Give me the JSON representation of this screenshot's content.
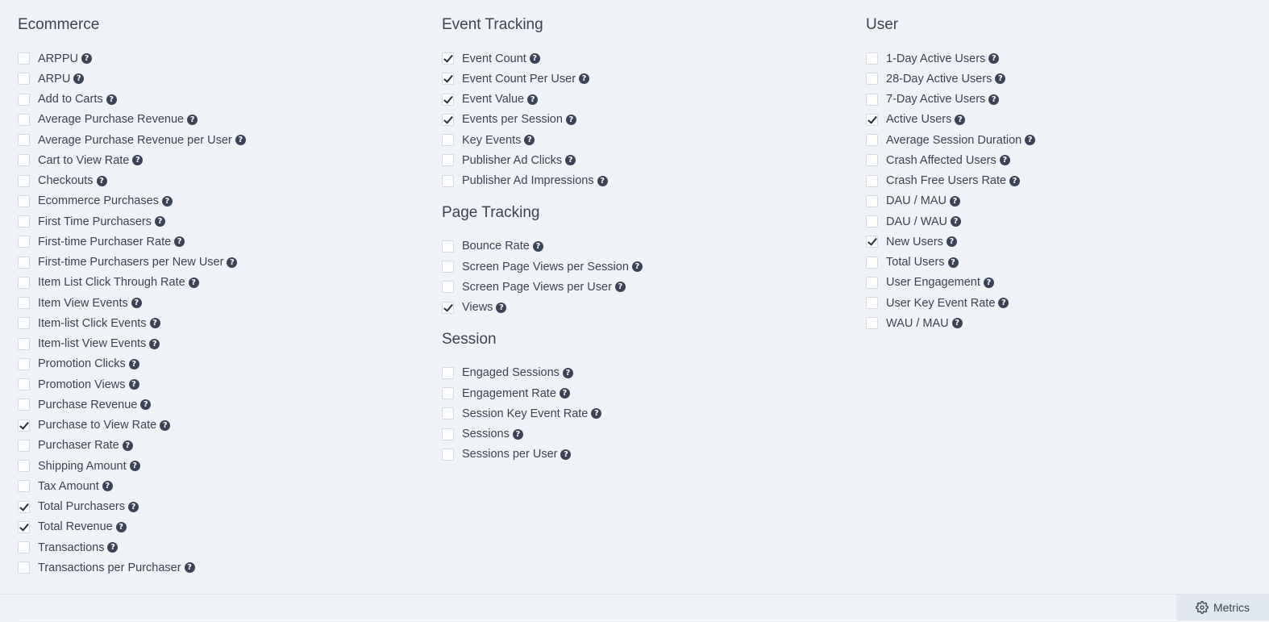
{
  "help_glyph": "?",
  "groups": {
    "ecommerce": {
      "title": "Ecommerce",
      "items": [
        {
          "label": "ARPPU",
          "checked": false
        },
        {
          "label": "ARPU",
          "checked": false
        },
        {
          "label": "Add to Carts",
          "checked": false
        },
        {
          "label": "Average Purchase Revenue",
          "checked": false
        },
        {
          "label": "Average Purchase Revenue per User",
          "checked": false
        },
        {
          "label": "Cart to View Rate",
          "checked": false
        },
        {
          "label": "Checkouts",
          "checked": false
        },
        {
          "label": "Ecommerce Purchases",
          "checked": false
        },
        {
          "label": "First Time Purchasers",
          "checked": false
        },
        {
          "label": "First-time Purchaser Rate",
          "checked": false
        },
        {
          "label": "First-time Purchasers per New User",
          "checked": false
        },
        {
          "label": "Item List Click Through Rate",
          "checked": false
        },
        {
          "label": "Item View Events",
          "checked": false
        },
        {
          "label": "Item-list Click Events",
          "checked": false
        },
        {
          "label": "Item-list View Events",
          "checked": false
        },
        {
          "label": "Promotion Clicks",
          "checked": false
        },
        {
          "label": "Promotion Views",
          "checked": false
        },
        {
          "label": "Purchase Revenue",
          "checked": false
        },
        {
          "label": "Purchase to View Rate",
          "checked": true
        },
        {
          "label": "Purchaser Rate",
          "checked": false
        },
        {
          "label": "Shipping Amount",
          "checked": false
        },
        {
          "label": "Tax Amount",
          "checked": false
        },
        {
          "label": "Total Purchasers",
          "checked": true
        },
        {
          "label": "Total Revenue",
          "checked": true
        },
        {
          "label": "Transactions",
          "checked": false
        },
        {
          "label": "Transactions per Purchaser",
          "checked": false
        }
      ]
    },
    "event_tracking": {
      "title": "Event Tracking",
      "items": [
        {
          "label": "Event Count",
          "checked": true
        },
        {
          "label": "Event Count Per User",
          "checked": true
        },
        {
          "label": "Event Value",
          "checked": true
        },
        {
          "label": "Events per Session",
          "checked": true
        },
        {
          "label": "Key Events",
          "checked": false
        },
        {
          "label": "Publisher Ad Clicks",
          "checked": false
        },
        {
          "label": "Publisher Ad Impressions",
          "checked": false
        }
      ]
    },
    "page_tracking": {
      "title": "Page Tracking",
      "items": [
        {
          "label": "Bounce Rate",
          "checked": false
        },
        {
          "label": "Screen Page Views per Session",
          "checked": false
        },
        {
          "label": "Screen Page Views per User",
          "checked": false
        },
        {
          "label": "Views",
          "checked": true
        }
      ]
    },
    "session": {
      "title": "Session",
      "items": [
        {
          "label": "Engaged Sessions",
          "checked": false
        },
        {
          "label": "Engagement Rate",
          "checked": false
        },
        {
          "label": "Session Key Event Rate",
          "checked": false
        },
        {
          "label": "Sessions",
          "checked": false
        },
        {
          "label": "Sessions per User",
          "checked": false
        }
      ]
    },
    "user": {
      "title": "User",
      "items": [
        {
          "label": "1-Day Active Users",
          "checked": false
        },
        {
          "label": "28-Day Active Users",
          "checked": false
        },
        {
          "label": "7-Day Active Users",
          "checked": false
        },
        {
          "label": "Active Users",
          "checked": true
        },
        {
          "label": "Average Session Duration",
          "checked": false
        },
        {
          "label": "Crash Affected Users",
          "checked": false
        },
        {
          "label": "Crash Free Users Rate",
          "checked": false
        },
        {
          "label": "DAU / MAU",
          "checked": false
        },
        {
          "label": "DAU / WAU",
          "checked": false
        },
        {
          "label": "New Users",
          "checked": true
        },
        {
          "label": "Total Users",
          "checked": false
        },
        {
          "label": "User Engagement",
          "checked": false
        },
        {
          "label": "User Key Event Rate",
          "checked": false
        },
        {
          "label": "WAU / MAU",
          "checked": false
        }
      ]
    }
  },
  "footer": {
    "metrics_label": "Metrics",
    "metrics_icon": "gear-icon"
  }
}
